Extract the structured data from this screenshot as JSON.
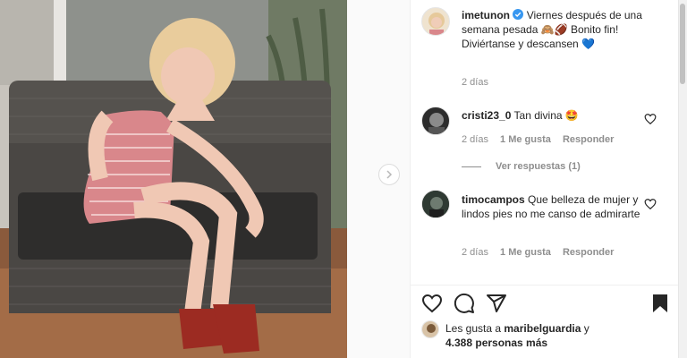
{
  "post": {
    "author": "imetunon",
    "caption": "Viernes después de una semana pesada 🙈🏈 Bonito fin! Diviértanse y descansen 💙",
    "age": "2 días"
  },
  "comments": [
    {
      "username": "cristi23_0",
      "text": "Tan divina 🤩",
      "age": "2 días",
      "likes": "1 Me gusta",
      "reply_label": "Responder",
      "view_replies": "Ver respuestas (1)"
    },
    {
      "username": "timocampos",
      "text": "Que belleza de mujer y lindos pies no me canso de admirarte",
      "age": "2 días",
      "likes": "1 Me gusta",
      "reply_label": "Responder"
    }
  ],
  "likes": {
    "prefix": "Les gusta a",
    "user": "maribelguardia",
    "connector": "y",
    "count": "4.388 personas más"
  },
  "icons": [
    "verified-badge-icon",
    "heart-icon",
    "comment-icon",
    "share-icon",
    "bookmark-icon",
    "chevron-right-icon"
  ],
  "colors": {
    "verified": "#3897f0",
    "text": "#262626",
    "muted": "#8e8e8e"
  }
}
